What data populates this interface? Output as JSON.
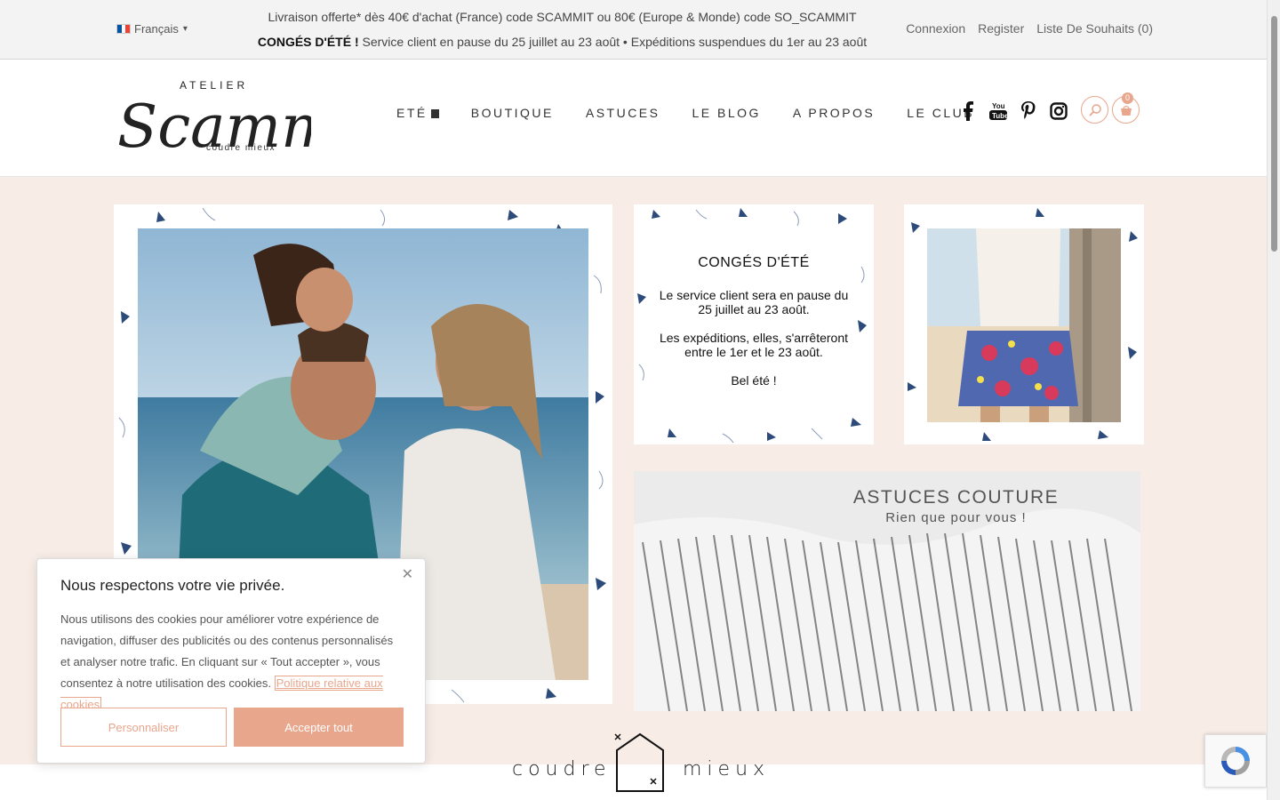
{
  "topbar": {
    "language": "Français",
    "promo_line1": "Livraison offerte* dès 40€ d'achat (France) code SCAMMIT ou 80€ (Europe & Monde) code SO_SCAMMIT",
    "promo_line2_bold": "CONGÉS D'ÉTÉ !",
    "promo_line2_rest": " Service client en pause du 25 juillet au 23 août • Expéditions suspendues du 1er au 23 août",
    "links": [
      "Connexion",
      "Register",
      "Liste De Souhaits (0)"
    ]
  },
  "logo": {
    "top": "ATELIER",
    "main": "Scammit",
    "tagline": "coudre mieux"
  },
  "nav": [
    "ETÉ",
    "BOUTIQUE",
    "ASTUCES",
    "LE BLOG",
    "A PROPOS",
    "LE CLUB"
  ],
  "social": [
    "facebook-icon",
    "youtube-icon",
    "pinterest-icon",
    "instagram-icon"
  ],
  "cart_count": "0",
  "conges": {
    "title": "CONGÉS D'ÉTÉ",
    "p1": "Le service client sera en pause du 25 juillet au 23 août.",
    "p2": "Les expéditions, elles, s'arrêteront entre le 1er et le 23 août.",
    "p3": "Bel été !"
  },
  "astuces": {
    "title": "ASTUCES COUTURE",
    "subtitle": "Rien que pour vous !"
  },
  "coudre_mieux": {
    "left": "coudre",
    "right": "mieux"
  },
  "cookie": {
    "title": "Nous respectons votre vie privée.",
    "body": "Nous utilisons des cookies pour améliorer votre expérience de navigation, diffuser des publicités ou des contenus personnalisés et analyser notre trafic. En cliquant sur « Tout accepter », vous consentez à notre utilisation des cookies. ",
    "link": "Politique relative aux cookies",
    "customize": "Personnaliser",
    "accept": "Accepter tout"
  },
  "colors": {
    "accent": "#e8a68d",
    "background": "#f8ece6"
  }
}
